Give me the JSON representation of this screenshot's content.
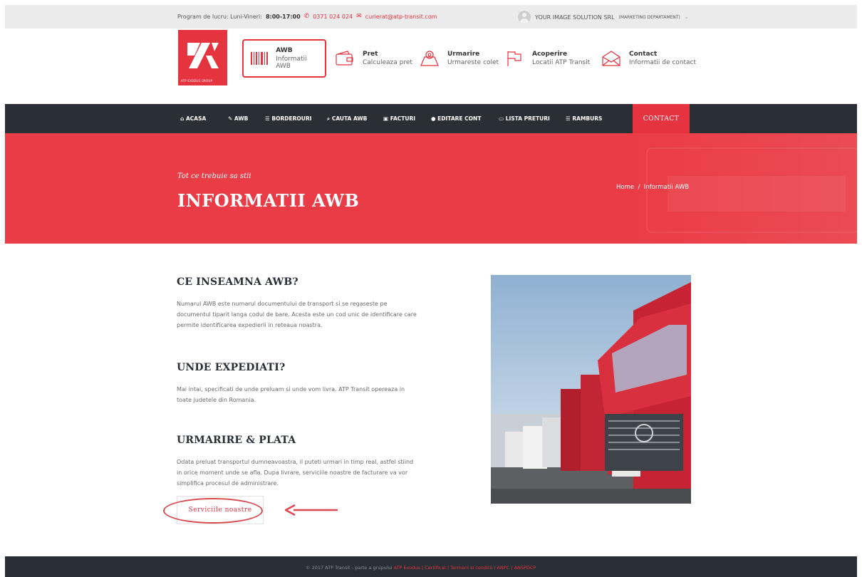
{
  "topbar": {
    "schedule_label": "Program de lucru: Luni-Vineri:",
    "schedule_hours": "8:00-17:00",
    "phone": "0371 024 024",
    "email": "curierat@atp-transit.com",
    "company": "YOUR IMAGE SOLUTION SRL",
    "department": "(MARKETING DEPARTAMENT)"
  },
  "logo": {
    "tagline": "ATP EXODUS GROUP"
  },
  "header_nav": [
    {
      "title": "AWB",
      "subtitle": "Informatii AWB",
      "icon": "barcode-icon"
    },
    {
      "title": "Pret",
      "subtitle": "Calculeaza pret",
      "icon": "wallet-icon"
    },
    {
      "title": "Urmarire",
      "subtitle": "Urmareste colet",
      "icon": "map-pin-icon"
    },
    {
      "title": "Acoperire",
      "subtitle": "Locatii ATP Transit",
      "icon": "flag-icon"
    },
    {
      "title": "Contact",
      "subtitle": "Informatii de contact",
      "icon": "envelope-icon"
    }
  ],
  "main_nav": {
    "items": [
      {
        "label": "ACASA",
        "icon": "home-icon",
        "glyph": "⌂"
      },
      {
        "label": "AWB",
        "icon": "pencil-icon",
        "glyph": "✎"
      },
      {
        "label": "BORDEROURI",
        "icon": "list-icon",
        "glyph": "☰"
      },
      {
        "label": "CAUTA AWB",
        "icon": "search-icon",
        "glyph": "⌕"
      },
      {
        "label": "FACTURI",
        "icon": "invoice-icon",
        "glyph": "▣"
      },
      {
        "label": "EDITARE CONT",
        "icon": "user-icon",
        "glyph": "●"
      },
      {
        "label": "LISTA PRETURI",
        "icon": "price-list-icon",
        "glyph": "▭"
      },
      {
        "label": "RAMBURS",
        "icon": "list-icon",
        "glyph": "☰"
      }
    ],
    "contact_label": "CONTACT"
  },
  "hero": {
    "subtitle": "Tot ce trebuie sa stii",
    "title": "INFORMATII AWB",
    "breadcrumb_home": "Home",
    "breadcrumb_sep": "/",
    "breadcrumb_current": "Informatii AWB"
  },
  "sections": [
    {
      "title": "CE INSEAMNA AWB?",
      "lines": [
        "Numarul AWB este numarul documentului de transport si se regaseste pe",
        "documentul tiparit langa codul de bare. Acesta este un cod unic de identificare care",
        "permite identificarea expedierii in reteaua noastra."
      ]
    },
    {
      "title": "UNDE EXPEDIATI?",
      "lines": [
        "Mai intai, specificati de unde preluam si unde vom livra. ATP Transit opereaza in",
        "toate judetele din Romania."
      ]
    },
    {
      "title": "URMARIRE & PLATA",
      "lines": [
        "Odata preluat transportul dumneavoastra, il puteti urmari in timp real, astfel stiind",
        "in orice moment unde se afla. Dupa livrare, serviciile noastre de facturare va vor",
        "simplifica procesul de administrare."
      ]
    }
  ],
  "cta_button": "Serviciile noastre",
  "colors": {
    "accent": "#e5333f",
    "dark": "#2a2f35"
  },
  "footer": {
    "text": "© 2017 ATP Transit - parte a grupului",
    "links": [
      "ATP Exodus",
      "Certificat",
      "Termeni si conditii",
      "ANPC",
      "ANSPDCP"
    ],
    "sep": "|"
  }
}
